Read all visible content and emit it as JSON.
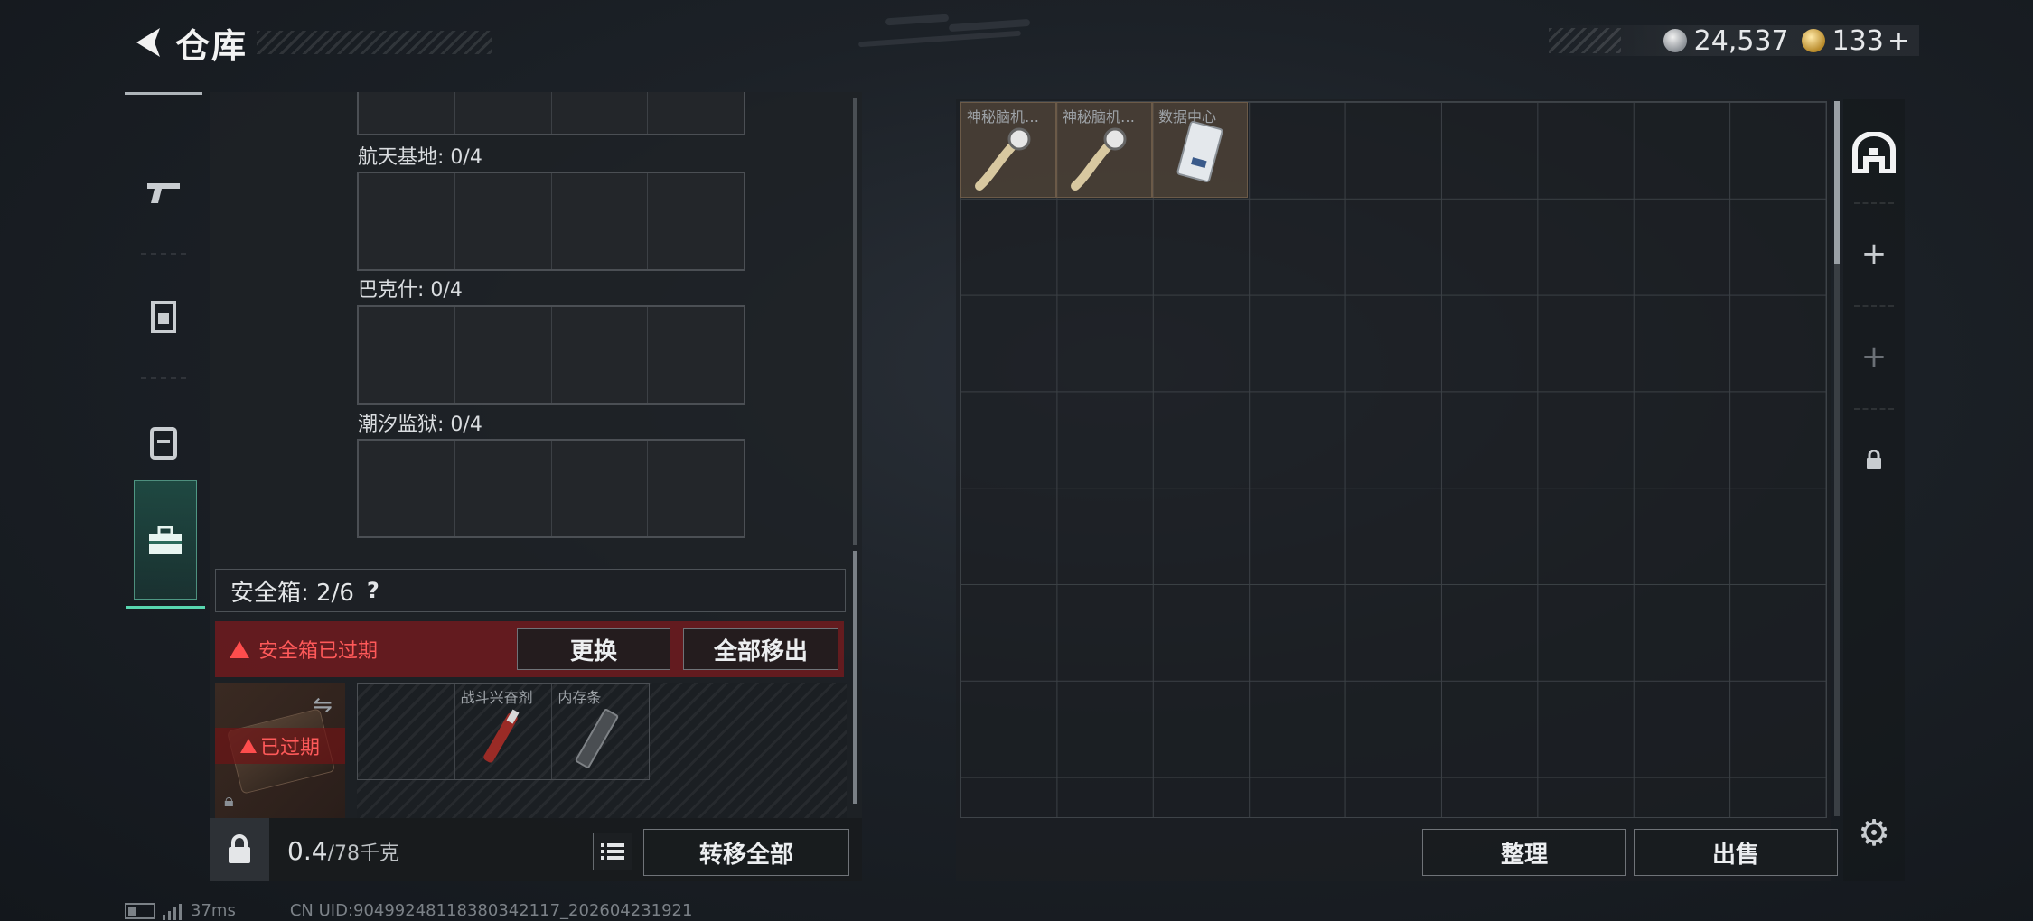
{
  "header": {
    "title": "仓库",
    "back_icon": "back-arrow-icon"
  },
  "currency": {
    "silver": "24,537",
    "gold": "133",
    "gold_add": "+"
  },
  "side_tabs": [
    {
      "icon": "pistol-icon",
      "active": false
    },
    {
      "icon": "armor-icon",
      "active": false
    },
    {
      "icon": "backpack-icon",
      "active": false
    },
    {
      "icon": "toolbox-icon",
      "active": true
    }
  ],
  "maps": [
    {
      "label": "航天基地: 0/4"
    },
    {
      "label": "巴克什: 0/4"
    },
    {
      "label": "潮汐监狱: 0/4"
    }
  ],
  "safebox": {
    "label": "安全箱: 2/6",
    "help": "?",
    "warning": "安全箱已过期",
    "replace_button": "更换",
    "remove_all_button": "全部移出",
    "expired_tag": "已过期",
    "items": [
      {
        "name": "",
        "icon": ""
      },
      {
        "name": "战斗兴奋剂",
        "icon": "stimulant-icon"
      },
      {
        "name": "内存条",
        "icon": "memory-stick-icon"
      }
    ]
  },
  "footer_left": {
    "weight_value": "0.4",
    "weight_cap": "/78千克",
    "transfer_all_button": "转移全部"
  },
  "stash": {
    "items": [
      {
        "name": "神秘脑机…",
        "icon": "brain-chip-icon"
      },
      {
        "name": "神秘脑机…",
        "icon": "brain-chip-icon"
      },
      {
        "name": "数据中心",
        "icon": "data-card-icon"
      }
    ],
    "sort_button": "整理",
    "sell_button": "出售"
  },
  "status": {
    "ping": "37ms",
    "uid": "CN UID:90499248118380342117_202604231921"
  },
  "colors": {
    "accent": "#58d6b0",
    "warning": "#ff4d4d",
    "panel": "#1e2226"
  }
}
